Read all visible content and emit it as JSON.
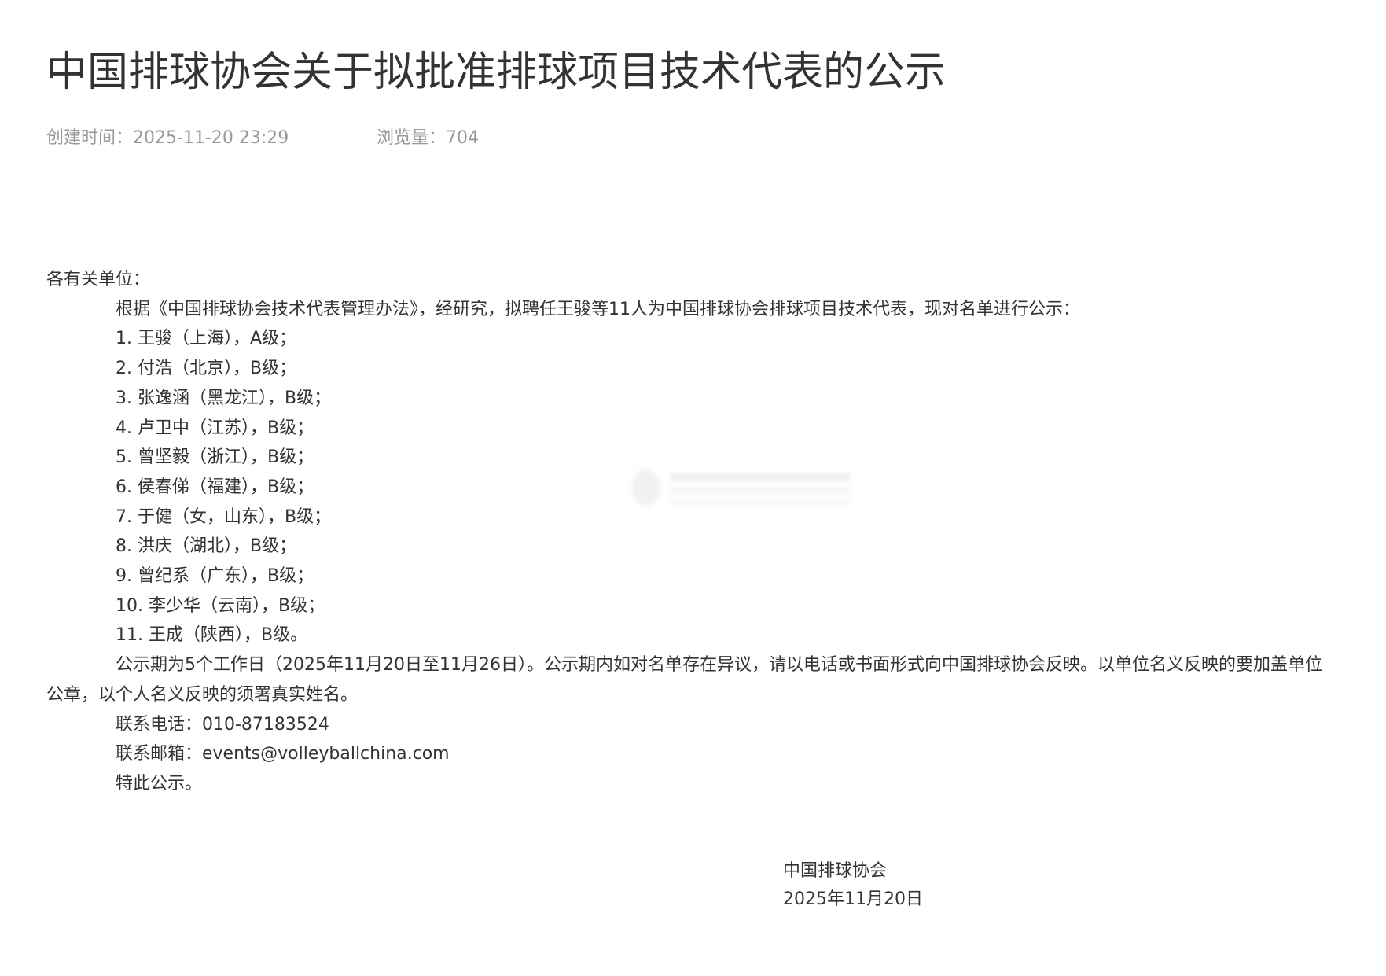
{
  "article": {
    "title": "中国排球协会关于拟批准排球项目技术代表的公示",
    "created_label": "创建时间：",
    "created_value": "2025-11-20 23:29",
    "views_label": "浏览量：",
    "views_value": "704"
  },
  "body": {
    "salutation": "各有关单位：",
    "intro": "根据《中国排球协会技术代表管理办法》，经研究，拟聘任王骏等11人为中国排球协会排球项目技术代表，现对名单进行公示：",
    "items": [
      "1. 王骏（上海），A级；",
      "2. 付浩（北京），B级；",
      "3. 张逸涵（黑龙江），B级；",
      "4. 卢卫中（江苏），B级；",
      "5. 曾坚毅（浙江），B级；",
      "6. 侯春俤（福建），B级；",
      "7. 于健（女，山东），B级；",
      "8. 洪庆（湖北），B级；",
      "9. 曾纪系（广东），B级；",
      "10. 李少华（云南），B级；",
      "11. 王成（陕西），B级。"
    ],
    "notice": "公示期为5个工作日（2025年11月20日至11月26日）。公示期内如对名单存在异议，请以电话或书面形式向中国排球协会反映。以单位名义反映的要加盖单位公章，以个人名义反映的须署真实姓名。",
    "phone": "联系电话：010-87183524",
    "email": "联系邮箱：events@volleyballchina.com",
    "closing": "特此公示。"
  },
  "signature": {
    "org": "中国排球协会",
    "date": "2025年11月20日"
  }
}
